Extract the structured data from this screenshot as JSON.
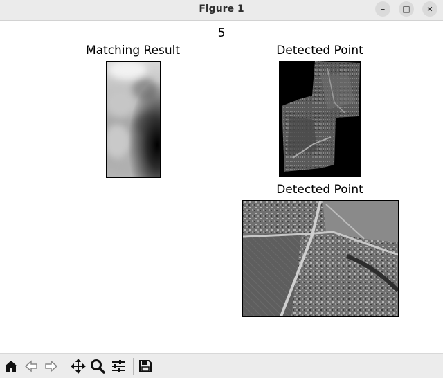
{
  "window": {
    "title": "Figure 1",
    "minimize": "–",
    "maximize": "□",
    "close": "✕"
  },
  "figure": {
    "suptitle": "5",
    "axes": [
      {
        "title": "Matching Result"
      },
      {
        "title": "Detected Point"
      },
      {
        "title": "Detected Point"
      }
    ]
  },
  "toolbar": {
    "buttons": [
      {
        "icon": "home-icon"
      },
      {
        "icon": "back-arrow-icon"
      },
      {
        "icon": "forward-arrow-icon"
      },
      {
        "icon": "pan-move-icon"
      },
      {
        "icon": "zoom-magnifier-icon"
      },
      {
        "icon": "configure-subplots-icon"
      },
      {
        "icon": "save-floppy-icon"
      }
    ]
  }
}
